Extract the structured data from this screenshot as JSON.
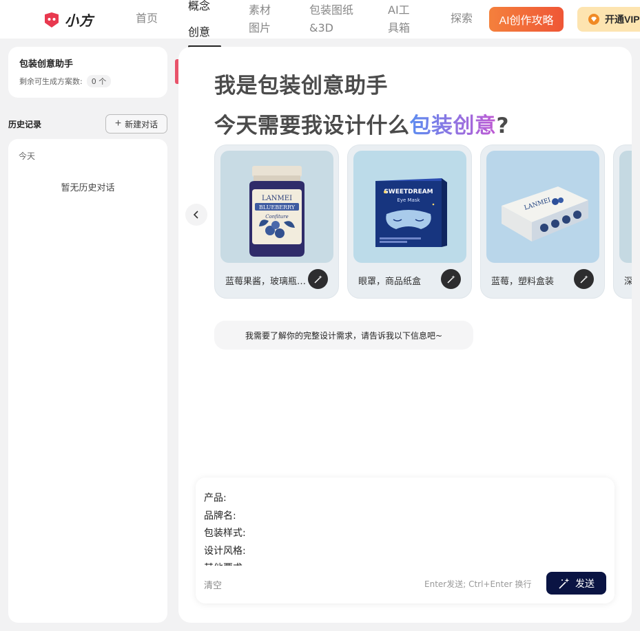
{
  "nav": {
    "logo_text": "小方",
    "home": "首页",
    "concept_line1": "概念",
    "concept_line2": "创意",
    "material_line1": "素材",
    "material_line2": "图片",
    "pack3d_line1": "包装图纸",
    "pack3d_line2": "&3D",
    "tools_line1": "AI工",
    "tools_line2": "具箱",
    "explore": "探索",
    "guide_button": "AI创作攻略",
    "vip_button": "开通VIP"
  },
  "sidebar": {
    "assistant_title": "包装创意助手",
    "remaining_label": "剩余可生成方案数:",
    "remaining_count": "0 个",
    "history_label": "历史记录",
    "new_chat_label": "新建对话",
    "today_label": "今天",
    "empty_text": "暂无历史对话"
  },
  "main": {
    "headline_line1": "我是包装创意助手",
    "headline_line2_prefix": "今天需要我设计什么",
    "headline_line2_highlight": "包装创意",
    "headline_line2_suffix": "?",
    "cards": [
      {
        "label": "蓝莓果酱，玻璃瓶包装",
        "image": "blueberry-jam-jar",
        "brand": "LANMEI",
        "banner": "BLUEBERRY",
        "script": "Confiture"
      },
      {
        "label": "眼罩，商品纸盒",
        "image": "eye-mask-box",
        "brand": "SWEETDREAM",
        "sub": "Eye Mask"
      },
      {
        "label": "蓝莓，塑料盒装",
        "image": "blueberry-plastic-box",
        "brand": "LANMEI"
      },
      {
        "label": "深",
        "image": "partial-card"
      }
    ],
    "prompt_text": "我需要了解你的完整设计需求，请告诉我以下信息吧~"
  },
  "input": {
    "lines": [
      "产品:",
      "品牌名:",
      "包装样式:",
      "设计风格:",
      "其他要求:"
    ],
    "clear_label": "清空",
    "hint": "Enter发送; Ctrl+Enter 换行",
    "send_label": "发送"
  },
  "colors": {
    "accent_dark": "#0a1443",
    "guide_orange": "#f4803c",
    "vip_gold": "#fde4b0",
    "logo_red": "#e8394f"
  }
}
